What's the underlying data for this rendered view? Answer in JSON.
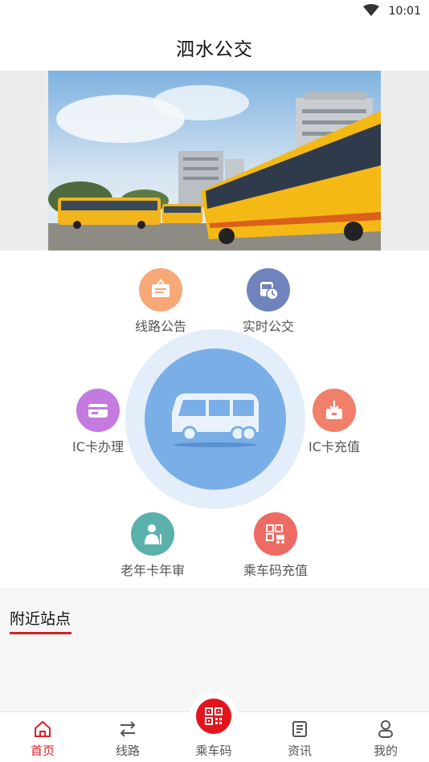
{
  "status_bar": {
    "time": "10:01"
  },
  "header": {
    "title": "泗水公交"
  },
  "banner": {
    "image": "yellow-buses-photo"
  },
  "menu": {
    "items": [
      {
        "label": "线路公告",
        "icon": "notice-board-icon",
        "color": "#f7a877"
      },
      {
        "label": "实时公交",
        "icon": "realtime-bus-icon",
        "color": "#6f84bd"
      },
      {
        "label": "IC卡办理",
        "icon": "card-icon",
        "color": "#c57ae0"
      },
      {
        "label": "IC卡充值",
        "icon": "card-recharge-icon",
        "color": "#f0806a"
      },
      {
        "label": "老年卡年审",
        "icon": "elderly-icon",
        "color": "#5bb0ac"
      },
      {
        "label": "乘车码充值",
        "icon": "qr-recharge-icon",
        "color": "#ee6b63"
      }
    ],
    "center_icon": "bus-icon"
  },
  "nearby": {
    "heading": "附近站点"
  },
  "bottom_nav": {
    "items": [
      {
        "label": "首页",
        "icon": "home-icon",
        "active": true
      },
      {
        "label": "线路",
        "icon": "route-icon",
        "active": false
      },
      {
        "label": "乘车码",
        "icon": "qr-code-icon",
        "active": false
      },
      {
        "label": "资讯",
        "icon": "news-icon",
        "active": false
      },
      {
        "label": "我的",
        "icon": "profile-icon",
        "active": false
      }
    ]
  },
  "colors": {
    "accent": "#d4222a",
    "qr_button": "#e2151d",
    "center_circle": "#7aaee7"
  }
}
